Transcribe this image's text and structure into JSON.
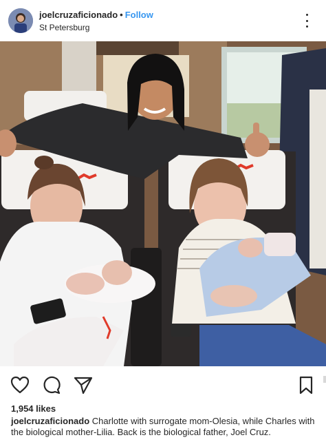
{
  "post": {
    "username": "joelcruzaficionado",
    "separator": "•",
    "follow_label": "Follow",
    "location": "St Petersburg",
    "likes": "1,954 likes",
    "caption_user": "joelcruzaficionado",
    "caption_text": "Charlotte with surrogate mom-Olesia, while Charles with the biological mother-Lilia. Back is the biological father, Joel Cruz."
  },
  "icons": {
    "more": "more-options-icon",
    "like": "heart-icon",
    "comment": "comment-icon",
    "share": "paper-plane-icon",
    "save": "bookmark-icon"
  },
  "colors": {
    "accent": "#3897f0",
    "text": "#262626"
  }
}
